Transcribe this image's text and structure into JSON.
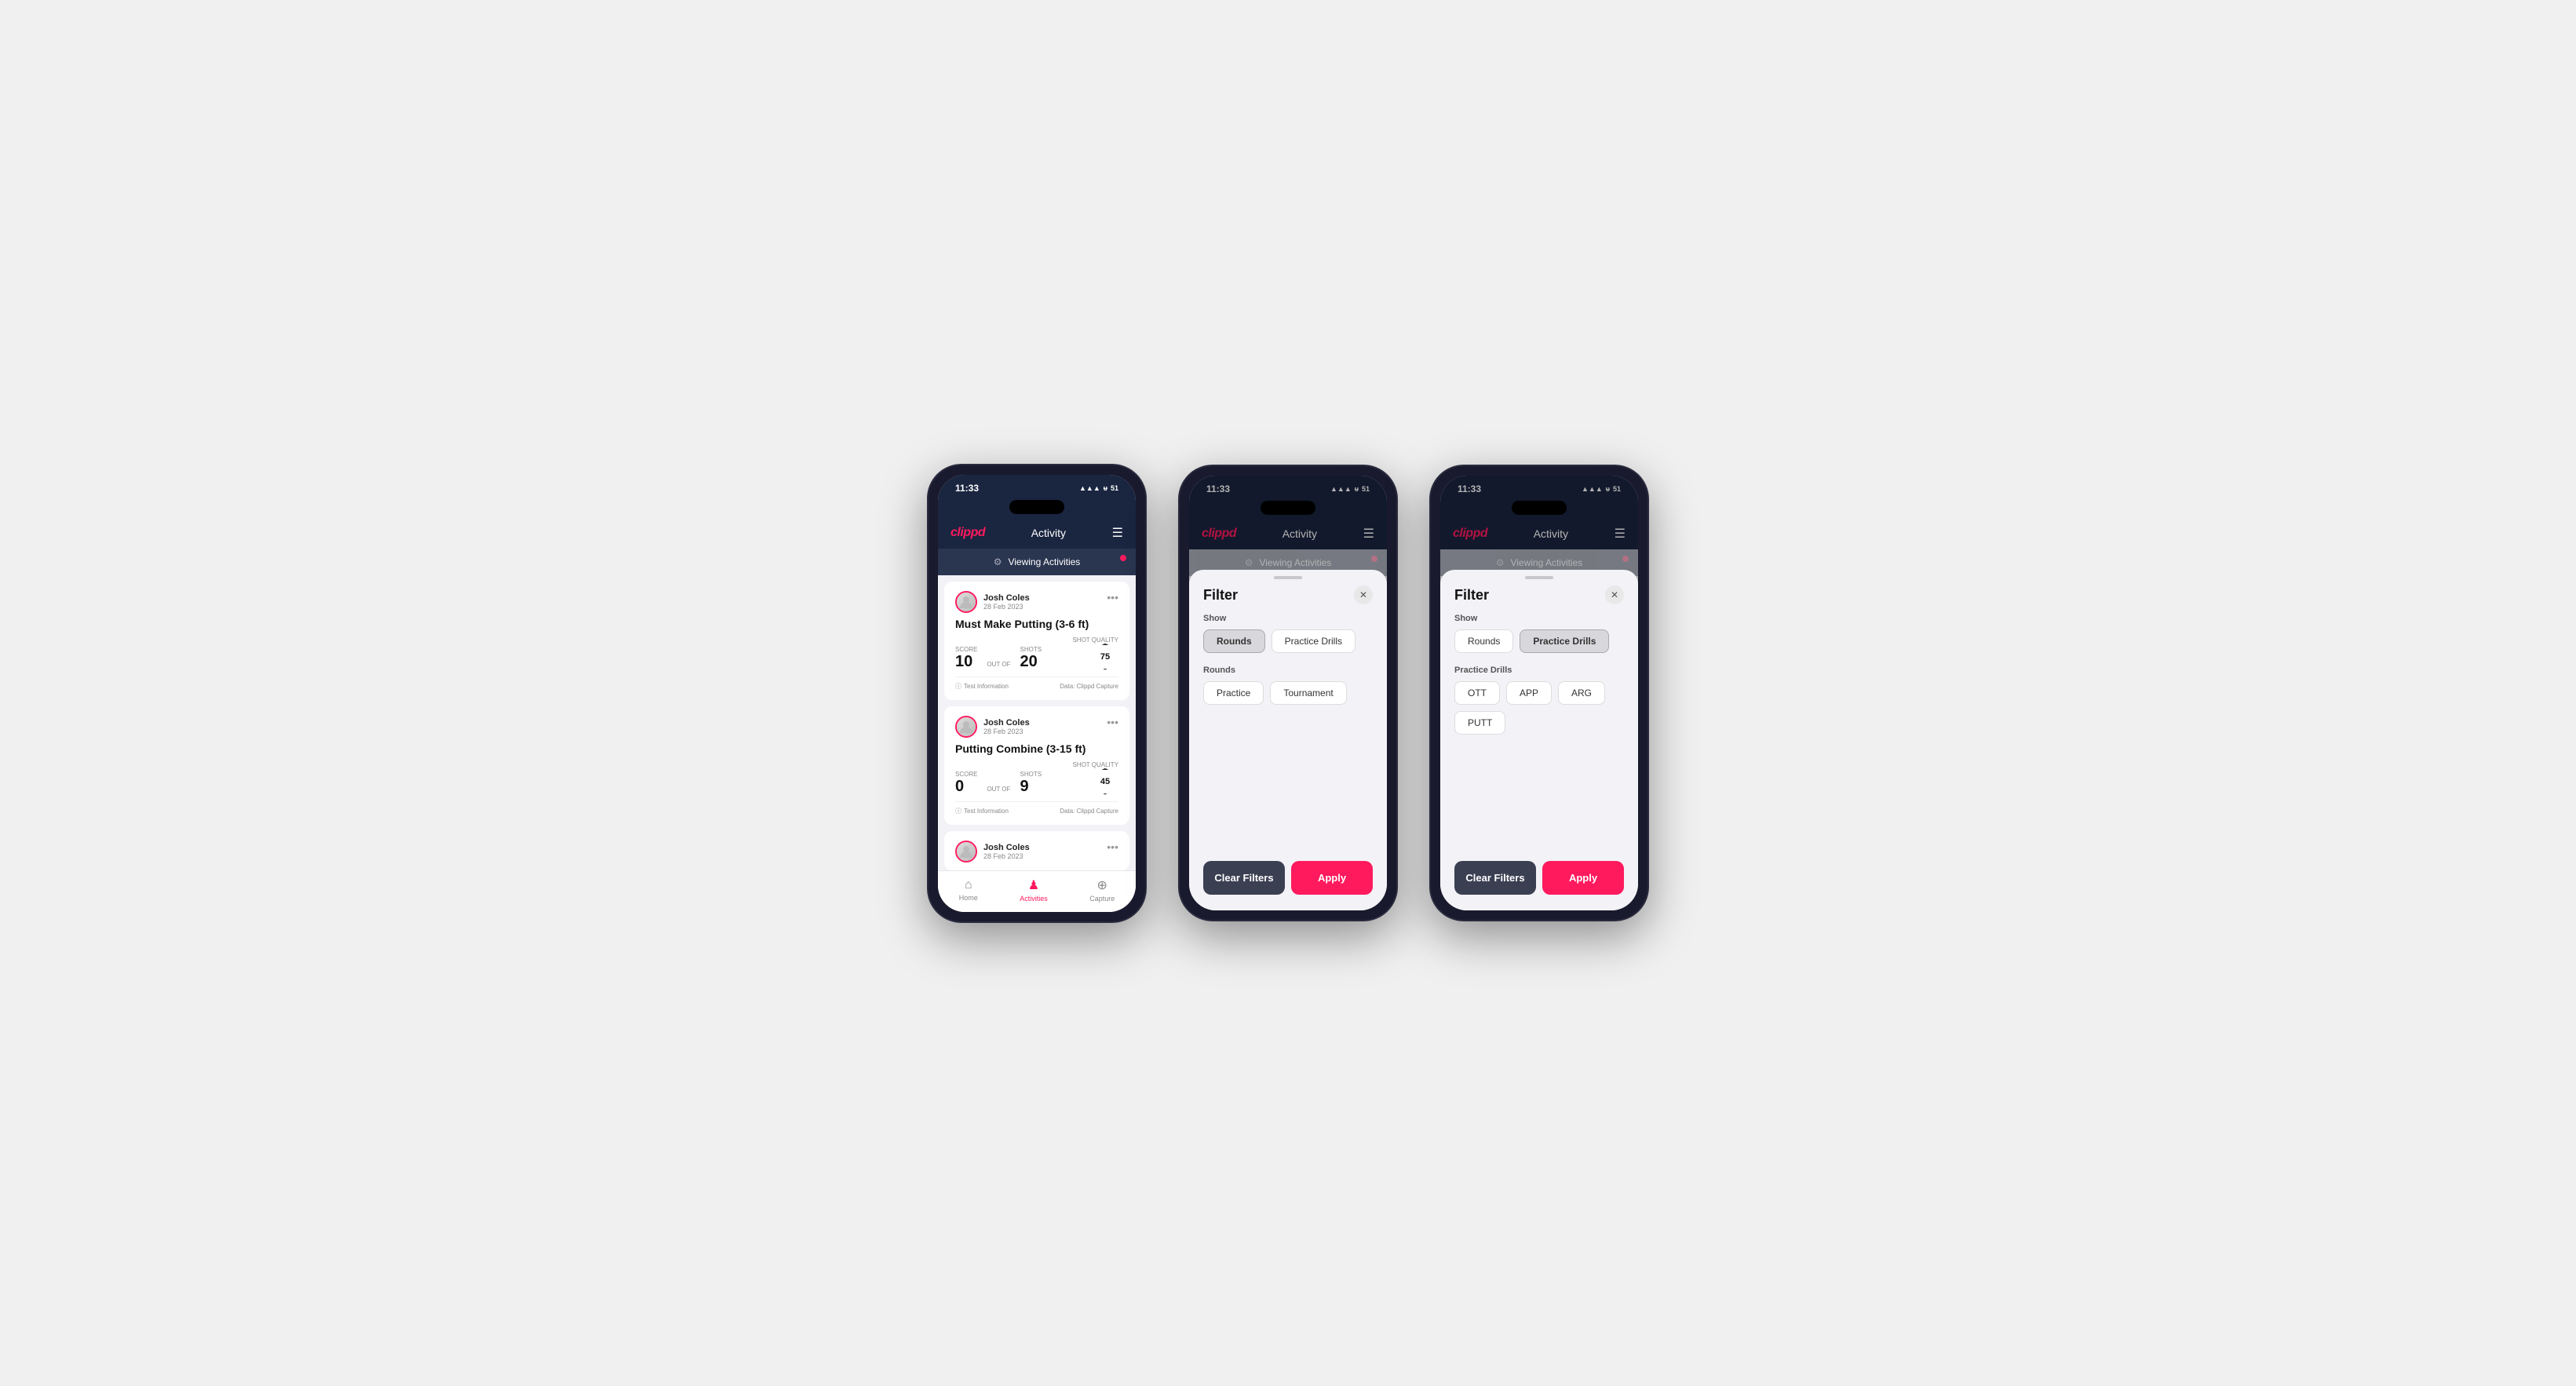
{
  "app": {
    "title": "Activity",
    "logo": "clippd",
    "time": "11:33",
    "status_icons": "▲ ᵾ 51"
  },
  "viewing_bar": {
    "label": "Viewing Activities"
  },
  "user": {
    "name": "Josh Coles",
    "date": "28 Feb 2023"
  },
  "activities": [
    {
      "title": "Must Make Putting (3-6 ft)",
      "score_label": "Score",
      "score_value": "10",
      "out_of": "OUT OF",
      "shots_label": "Shots",
      "shots_value": "20",
      "quality_label": "Shot Quality",
      "quality_value": "75",
      "test_info": "Test Information",
      "data_source": "Data: Clippd Capture"
    },
    {
      "title": "Putting Combine (3-15 ft)",
      "score_label": "Score",
      "score_value": "0",
      "out_of": "OUT OF",
      "shots_label": "Shots",
      "shots_value": "9",
      "quality_label": "Shot Quality",
      "quality_value": "45",
      "test_info": "Test Information",
      "data_source": "Data: Clippd Capture"
    }
  ],
  "nav": {
    "home_label": "Home",
    "activities_label": "Activities",
    "capture_label": "Capture"
  },
  "filter": {
    "title": "Filter",
    "show_label": "Show",
    "rounds_label": "Rounds",
    "practice_drills_label": "Practice Drills",
    "rounds_section_label": "Rounds",
    "practice_label": "Practice",
    "tournament_label": "Tournament",
    "practice_drills_section_label": "Practice Drills",
    "ott_label": "OTT",
    "app_label": "APP",
    "arg_label": "ARG",
    "putt_label": "PUTT",
    "clear_filters_label": "Clear Filters",
    "apply_label": "Apply"
  },
  "phone2": {
    "show_active": "rounds",
    "show_section": "Rounds"
  },
  "phone3": {
    "show_active": "practice_drills",
    "show_section": "Practice Drills"
  }
}
